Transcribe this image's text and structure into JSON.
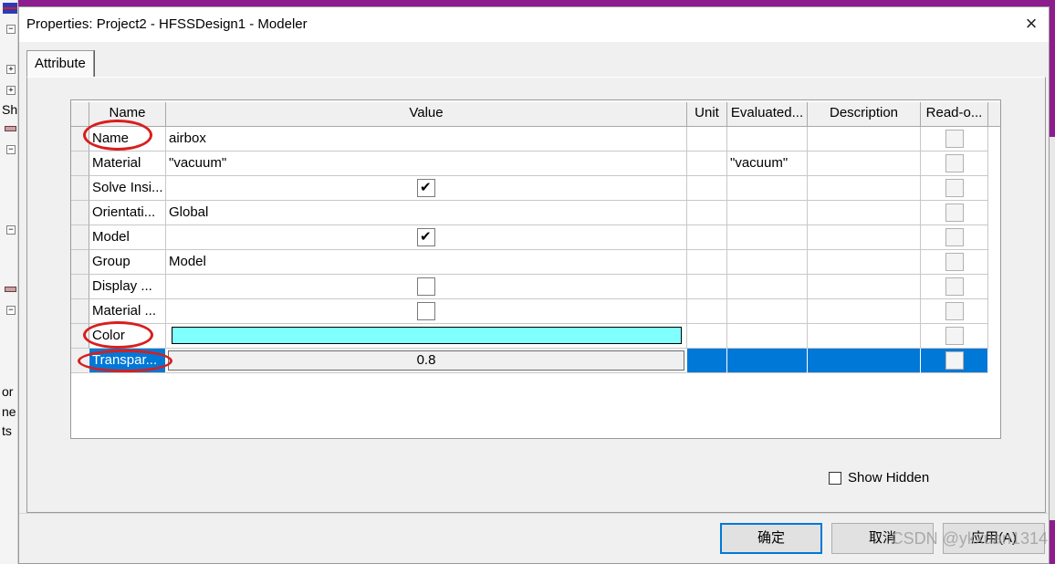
{
  "background": {
    "left_texts": [
      "Sh",
      "or",
      "ne",
      "ts"
    ],
    "purple": "#8d1d8f"
  },
  "dialog": {
    "title": "Properties: Project2 - HFSSDesign1 - Modeler",
    "close_icon": "×",
    "tab_label": "Attribute"
  },
  "grid": {
    "columns": [
      "Name",
      "Value",
      "Unit",
      "Evaluated...",
      "Description",
      "Read-o..."
    ],
    "rows": [
      {
        "name": "Name",
        "value": "airbox",
        "unit": "",
        "evaluated": "",
        "description": ""
      },
      {
        "name": "Material",
        "value": "\"vacuum\"",
        "unit": "",
        "evaluated": "\"vacuum\"",
        "description": ""
      },
      {
        "name": "Solve Insi...",
        "value_checkbox": true,
        "unit": "",
        "evaluated": "",
        "description": ""
      },
      {
        "name": "Orientati...",
        "value": "Global",
        "unit": "",
        "evaluated": "",
        "description": ""
      },
      {
        "name": "Model",
        "value_checkbox": true,
        "unit": "",
        "evaluated": "",
        "description": ""
      },
      {
        "name": "Group",
        "value": "Model",
        "unit": "",
        "evaluated": "",
        "description": ""
      },
      {
        "name": "Display ...",
        "value_checkbox": false,
        "unit": "",
        "evaluated": "",
        "description": ""
      },
      {
        "name": "Material ...",
        "value_checkbox": false,
        "unit": "",
        "evaluated": "",
        "description": ""
      },
      {
        "name": "Color",
        "color": "#80ffff",
        "unit": "",
        "evaluated": "",
        "description": ""
      },
      {
        "name": "Transpar...",
        "value": "0.8",
        "unit": "",
        "evaluated": "",
        "description": "",
        "selected": true
      }
    ],
    "selection_color": "#0078d7"
  },
  "show_hidden": {
    "label": "Show Hidden",
    "checked": false
  },
  "buttons": {
    "ok": "确定",
    "cancel": "取消",
    "apply": "应用(A)"
  },
  "watermark": "CSDN @ykxuan1314",
  "annotation_color": "#d81e1e"
}
